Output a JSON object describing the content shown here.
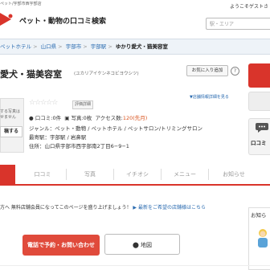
{
  "header": {
    "topLeft": "ペット/宇部市西宇部店",
    "welcome": "ようこそゲストさ",
    "logoText": "ペット・動物の口コミ検索",
    "searchPlaceholder": "駅・エリア"
  },
  "breadcrumb": [
    "ペットホテル",
    "山口県",
    "宇部市",
    "宇部駅",
    "ゆかり愛犬・猫美容室"
  ],
  "shop": {
    "name": "愛犬・猫美容室",
    "kana": "(ユカリアイケンネコビヨウシツ)",
    "favButton": "お気に入り追加",
    "helpIcon": "?",
    "stars": "☆☆☆☆☆",
    "ratingBadge": "評価詳細",
    "infoLink": "▼店舗情報詳細を見る",
    "reviewsLabel": "口コミ:",
    "reviewsCount": "0件",
    "photosLabel": "写真:",
    "photosCount": "0枚",
    "accessLabel": "アクセス数:",
    "accessCount": "120",
    "accessUnit": "(先月)",
    "genre": "ジャンル：ペット・動物 / ペットホテル / ペットサロン/トリミングサロン",
    "station": "最寄駅：宇部駅 / 岩鼻駅",
    "address": "住所：山口県宇部市西宇部南2丁目6−9−1"
  },
  "placeholder": {
    "line1": "する写真は",
    "line2": "せません",
    "button": "稿する"
  },
  "rightPanel": {
    "reviewCardLabel": "口コミ",
    "sideTitle": "お知ら"
  },
  "tabs": [
    "",
    "口コミ",
    "写真",
    "イチオシ",
    "メニュー",
    "お知らせ"
  ],
  "notice": {
    "text": "方へ 無料店舗会員になってこのページを盛り上げましょう！",
    "link": "▶ 最新をご希望の店舗様はこちら"
  },
  "actions": {
    "reserve": "電話で予約・お問い合わせ",
    "map": "地図"
  },
  "colors": {
    "accentRed": "#d9342b",
    "link": "#2a6bb0",
    "highlight": "#d9531e"
  }
}
